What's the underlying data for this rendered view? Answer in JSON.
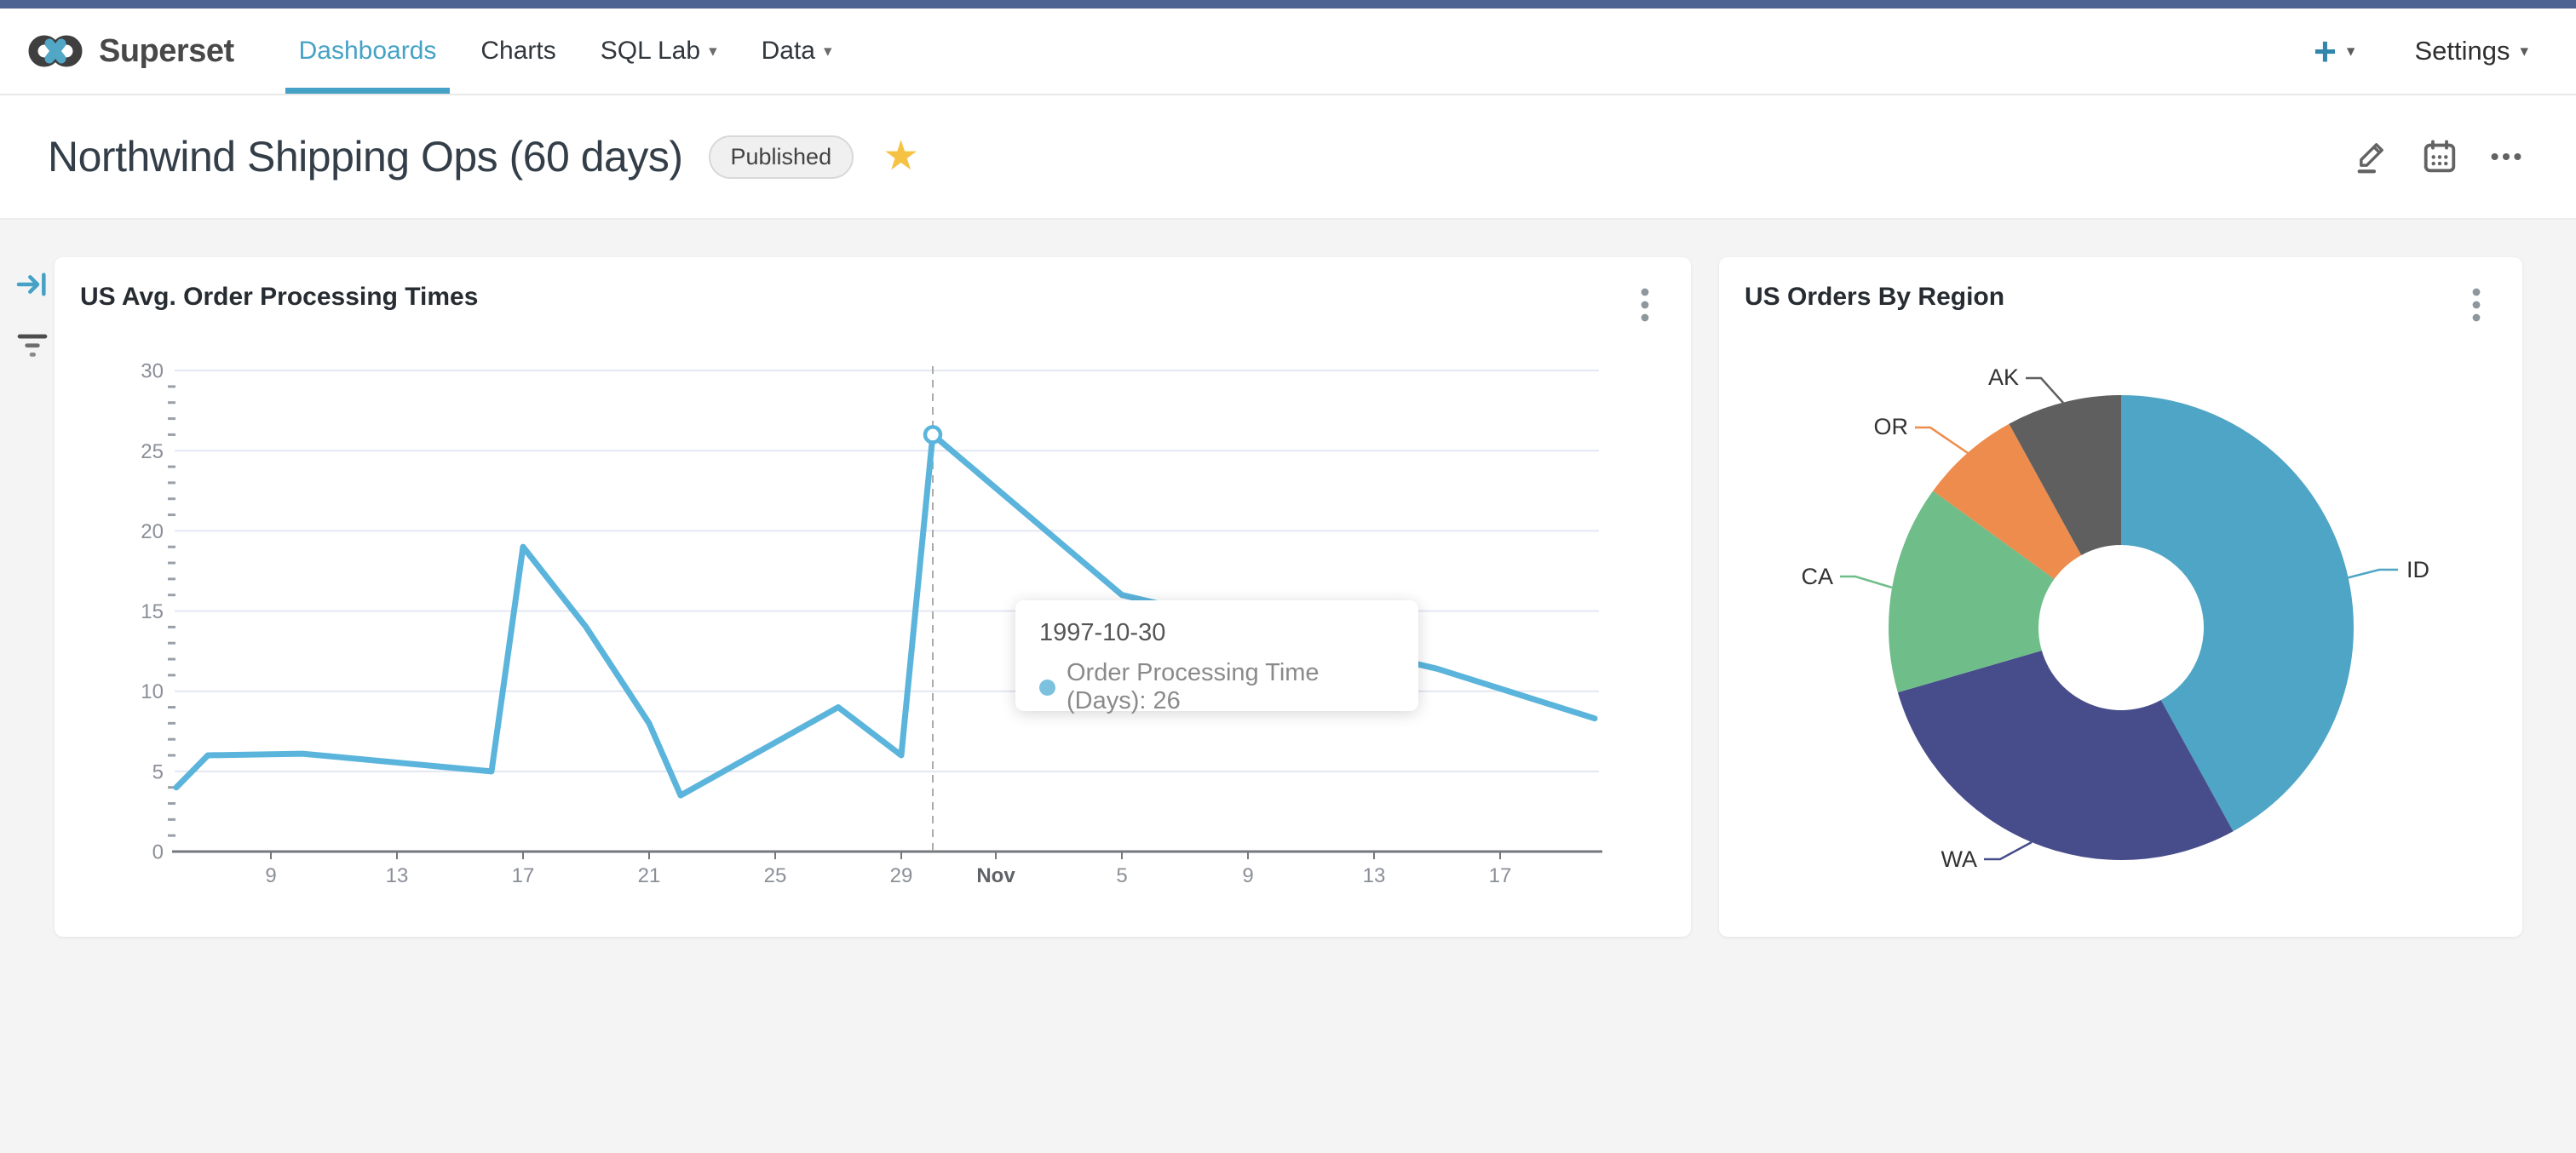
{
  "topbar": {
    "color": "#4e6391"
  },
  "navbar": {
    "brand": "Superset",
    "caret_glyph": "▾",
    "items": [
      {
        "label": "Dashboards",
        "active": true,
        "caret": false
      },
      {
        "label": "Charts",
        "active": false,
        "caret": false
      },
      {
        "label": "SQL Lab",
        "active": false,
        "caret": true
      },
      {
        "label": "Data",
        "active": false,
        "caret": true
      }
    ],
    "plus_label": "+",
    "settings_label": "Settings"
  },
  "header": {
    "title": "Northwind Shipping Ops (60 days)",
    "badge": "Published",
    "star_glyph": "★",
    "accent_color": "#45a2c6"
  },
  "chart_data": [
    {
      "type": "line",
      "title": "US Avg. Order Processing Times",
      "series": [
        {
          "name": "Order Processing Time (Days)",
          "color": "#5bb4db",
          "points": [
            [
              "1997-10-06",
              4
            ],
            [
              "1997-10-07",
              6
            ],
            [
              "1997-10-10",
              6.1
            ],
            [
              "1997-10-16",
              5
            ],
            [
              "1997-10-17",
              19
            ],
            [
              "1997-10-19",
              14
            ],
            [
              "1997-10-21",
              8
            ],
            [
              "1997-10-22",
              3.5
            ],
            [
              "1997-10-27",
              9
            ],
            [
              "1997-10-29",
              6
            ],
            [
              "1997-10-30",
              26
            ],
            [
              "1997-11-05",
              16
            ],
            [
              "1997-11-15",
              11.4
            ],
            [
              "1997-11-20",
              8.3
            ]
          ]
        }
      ],
      "ylim": [
        0,
        30
      ],
      "y_ticks": [
        0,
        5,
        10,
        15,
        20,
        25,
        30
      ],
      "x_ticks": [
        {
          "label": "9",
          "day": 9,
          "bold": false
        },
        {
          "label": "13",
          "day": 13,
          "bold": false
        },
        {
          "label": "17",
          "day": 17,
          "bold": false
        },
        {
          "label": "21",
          "day": 21,
          "bold": false
        },
        {
          "label": "25",
          "day": 25,
          "bold": false
        },
        {
          "label": "29",
          "day": 29,
          "bold": false
        },
        {
          "label": "Nov",
          "day": 32,
          "bold": true
        },
        {
          "label": "5",
          "day": 36,
          "bold": false
        },
        {
          "label": "9",
          "day": 40,
          "bold": false
        },
        {
          "label": "13",
          "day": 44,
          "bold": false
        },
        {
          "label": "17",
          "day": 48,
          "bold": false
        }
      ],
      "grid": true,
      "highlight": {
        "date": "1997-10-30",
        "value": 26
      },
      "tooltip": {
        "title": "1997-10-30",
        "label": "Order Processing Time (Days)",
        "value": 26
      }
    },
    {
      "type": "pie",
      "title": "US Orders By Region",
      "donut": true,
      "legend_position": "none",
      "label_style": "outside-leader",
      "labels": [
        "ID",
        "WA",
        "CA",
        "OR",
        "AK"
      ],
      "share_pct": [
        42,
        28.5,
        14.5,
        7,
        8
      ],
      "colors": [
        "#4fa5c5",
        "#474d8b",
        "#6fbe8a",
        "#ed8c4c",
        "#5f5f5f"
      ]
    }
  ]
}
